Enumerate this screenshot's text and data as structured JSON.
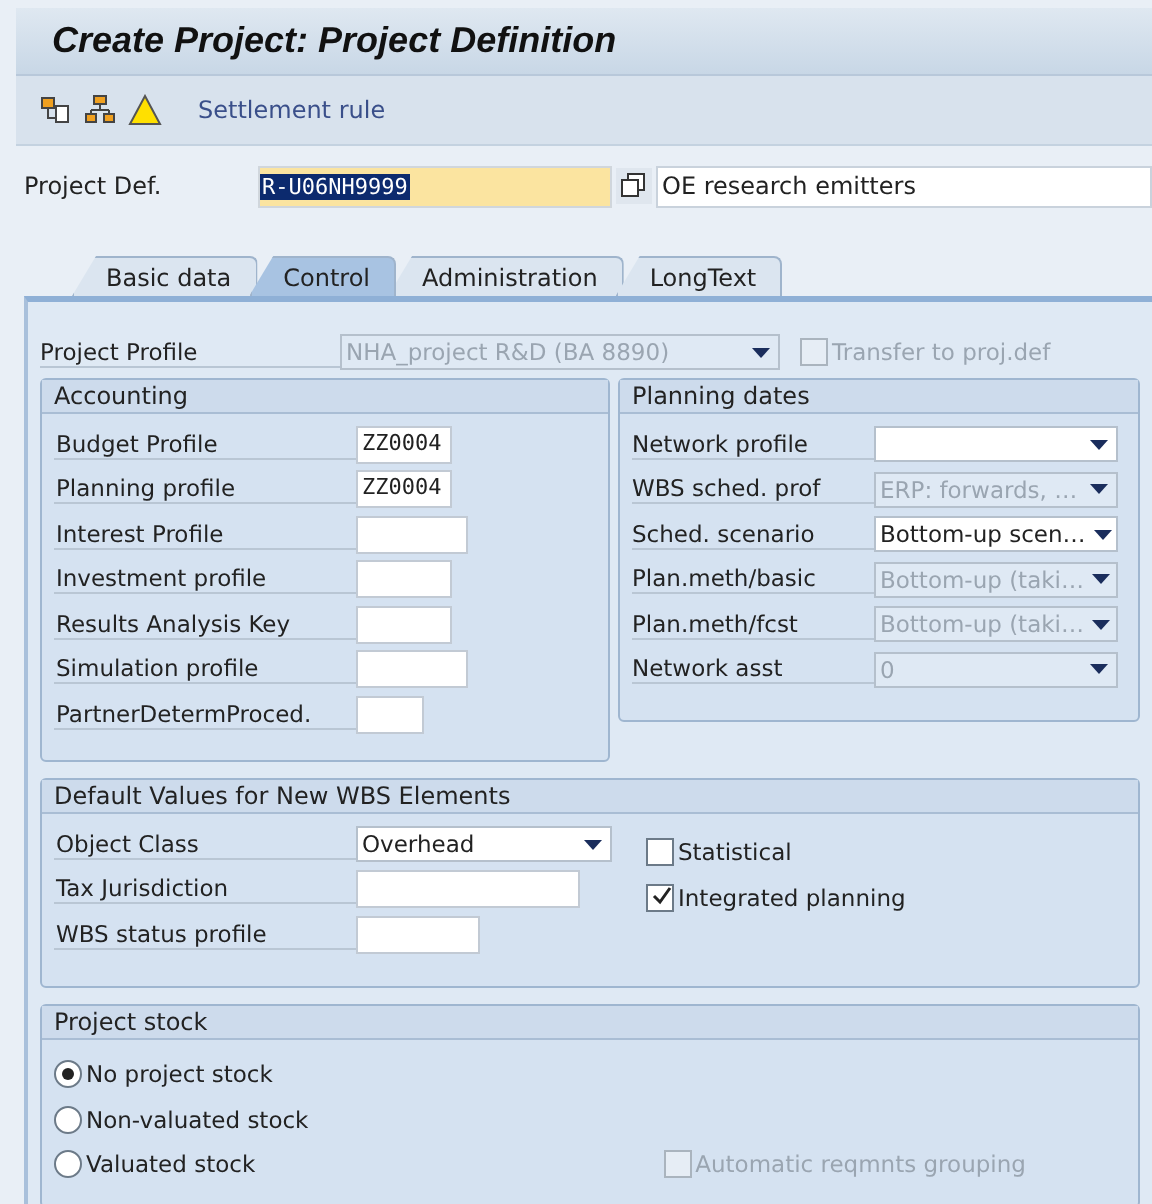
{
  "window": {
    "title": "Create Project: Project Definition"
  },
  "toolbar": {
    "settlement": "Settlement rule"
  },
  "project_def": {
    "label": "Project Def.",
    "value": "R-U06NH9999",
    "selected": true,
    "description": "OE research emitters"
  },
  "tabs": [
    {
      "label": "Basic data",
      "selected": false
    },
    {
      "label": "Control",
      "selected": true
    },
    {
      "label": "Administration",
      "selected": false
    },
    {
      "label": "LongText",
      "selected": false
    }
  ],
  "project_profile": {
    "label": "Project Profile",
    "value": "NHA_project R&D  (BA 8890)",
    "disabled": true
  },
  "transfer": {
    "label": "Transfer to proj.def",
    "checked": false,
    "disabled": true
  },
  "accounting": {
    "title": "Accounting",
    "fields": [
      {
        "label": "Budget Profile",
        "value": "ZZ0004"
      },
      {
        "label": "Planning profile",
        "value": "ZZ0004"
      },
      {
        "label": "Interest Profile"
      },
      {
        "label": "Investment profile"
      },
      {
        "label": "Results Analysis Key"
      },
      {
        "label": "Simulation profile"
      },
      {
        "label": "PartnerDetermProced."
      }
    ]
  },
  "planning_dates": {
    "title": "Planning dates",
    "fields": [
      {
        "label": "Network profile",
        "disabled": false
      },
      {
        "label": "WBS sched. prof",
        "value": "ERP: forwards, …",
        "disabled": true
      },
      {
        "label": "Sched. scenario",
        "value": "Bottom-up scen…",
        "disabled": false
      },
      {
        "label": "Plan.meth/basic",
        "value": "Bottom-up (taki…",
        "disabled": true
      },
      {
        "label": "Plan.meth/fcst",
        "value": "Bottom-up (taki…",
        "disabled": true
      },
      {
        "label": "Network asst",
        "value": "0",
        "disabled": true
      }
    ]
  },
  "wbs_defaults": {
    "title": "Default Values for New WBS Elements",
    "fields": [
      {
        "label": "Object Class",
        "value": "Overhead",
        "kind": "dropdown"
      },
      {
        "label": "Tax Jurisdiction",
        "kind": "text"
      },
      {
        "label": "WBS status profile",
        "kind": "text"
      }
    ],
    "checkboxes": [
      {
        "label": "Statistical",
        "checked": false
      },
      {
        "label": "Integrated planning",
        "checked": true
      }
    ]
  },
  "project_stock": {
    "title": "Project stock",
    "options": [
      {
        "label": "No project stock",
        "selected": true
      },
      {
        "label": "Non-valuated stock",
        "selected": false
      },
      {
        "label": "Valuated stock",
        "selected": false
      }
    ],
    "grouping": {
      "label": "Automatic reqmnts grouping",
      "checked": false,
      "disabled": true
    }
  }
}
